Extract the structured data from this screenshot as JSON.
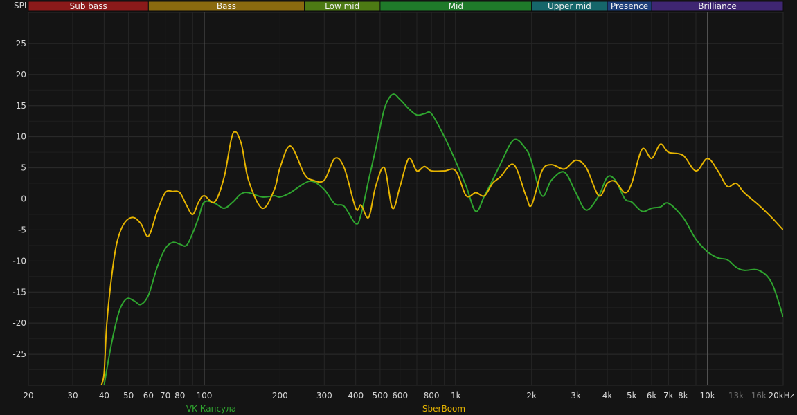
{
  "chart_data": {
    "type": "line",
    "ylabel": "SPL",
    "xscale": "log",
    "xlim": [
      20,
      20000
    ],
    "ylim": [
      -30,
      30
    ],
    "grid": true,
    "y_ticks": [
      25,
      20,
      15,
      10,
      5,
      0,
      -5,
      -10,
      -15,
      -20,
      -25
    ],
    "x_ticks": [
      {
        "value": 20,
        "label": "20",
        "dim": false
      },
      {
        "value": 30,
        "label": "30",
        "dim": false
      },
      {
        "value": 40,
        "label": "40",
        "dim": false
      },
      {
        "value": 50,
        "label": "50",
        "dim": false
      },
      {
        "value": 60,
        "label": "60",
        "dim": false
      },
      {
        "value": 70,
        "label": "70",
        "dim": false
      },
      {
        "value": 80,
        "label": "80",
        "dim": false
      },
      {
        "value": 100,
        "label": "100",
        "dim": false
      },
      {
        "value": 200,
        "label": "200",
        "dim": false
      },
      {
        "value": 300,
        "label": "300",
        "dim": false
      },
      {
        "value": 400,
        "label": "400",
        "dim": false
      },
      {
        "value": 500,
        "label": "500",
        "dim": false
      },
      {
        "value": 600,
        "label": "600",
        "dim": false
      },
      {
        "value": 800,
        "label": "800",
        "dim": false
      },
      {
        "value": 1000,
        "label": "1k",
        "dim": false
      },
      {
        "value": 2000,
        "label": "2k",
        "dim": false
      },
      {
        "value": 3000,
        "label": "3k",
        "dim": false
      },
      {
        "value": 4000,
        "label": "4k",
        "dim": false
      },
      {
        "value": 5000,
        "label": "5k",
        "dim": false
      },
      {
        "value": 6000,
        "label": "6k",
        "dim": false
      },
      {
        "value": 7000,
        "label": "7k",
        "dim": false
      },
      {
        "value": 8000,
        "label": "8k",
        "dim": false
      },
      {
        "value": 10000,
        "label": "10k",
        "dim": false
      },
      {
        "value": 13000,
        "label": "13k",
        "dim": true
      },
      {
        "value": 16000,
        "label": "16k",
        "dim": true
      },
      {
        "value": 20000,
        "label": "20kHz",
        "dim": false
      }
    ],
    "bands": [
      {
        "name": "Sub bass",
        "from": 20,
        "to": 60,
        "color": "#8b1a1a"
      },
      {
        "name": "Bass",
        "from": 60,
        "to": 250,
        "color": "#8a6a0f"
      },
      {
        "name": "Low mid",
        "from": 250,
        "to": 500,
        "color": "#4d7a14"
      },
      {
        "name": "Mid",
        "from": 500,
        "to": 2000,
        "color": "#1f7a2a"
      },
      {
        "name": "Upper mid",
        "from": 2000,
        "to": 4000,
        "color": "#16666a"
      },
      {
        "name": "Presence",
        "from": 4000,
        "to": 6000,
        "color": "#1d3f7a"
      },
      {
        "name": "Brilliance",
        "from": 6000,
        "to": 20000,
        "color": "#3f2672"
      }
    ],
    "series": [
      {
        "name": "VK Капсула",
        "color": "#2fa52f",
        "x": [
          40,
          42,
          44,
          46,
          48,
          50,
          53,
          56,
          60,
          65,
          70,
          75,
          80,
          85,
          90,
          95,
          100,
          110,
          120,
          130,
          140,
          150,
          170,
          190,
          200,
          220,
          250,
          270,
          300,
          330,
          360,
          400,
          420,
          450,
          480,
          520,
          560,
          600,
          650,
          700,
          750,
          800,
          900,
          1000,
          1100,
          1200,
          1300,
          1400,
          1500,
          1700,
          1900,
          2000,
          2200,
          2400,
          2700,
          3000,
          3300,
          3700,
          4000,
          4300,
          4700,
          5000,
          5500,
          6000,
          6500,
          7000,
          8000,
          9000,
          10000,
          11000,
          12000,
          13000,
          14000,
          16000,
          18000,
          20000
        ],
        "values": [
          -30,
          -25,
          -21,
          -18,
          -16.5,
          -16,
          -16.5,
          -17,
          -15.5,
          -11,
          -8,
          -7,
          -7.3,
          -7.5,
          -5.5,
          -3,
          -0.5,
          -0.7,
          -1.5,
          -0.5,
          0.8,
          1.0,
          0.3,
          0.5,
          0.3,
          1.0,
          2.5,
          2.8,
          1.5,
          -0.8,
          -1.2,
          -4.0,
          -2.5,
          3.0,
          8.0,
          14.5,
          16.8,
          16.0,
          14.5,
          13.5,
          13.7,
          13.7,
          10.0,
          6.0,
          2.0,
          -2.0,
          0.5,
          3.0,
          5.5,
          9.5,
          8.0,
          6.0,
          0.5,
          3.0,
          4.3,
          1.0,
          -1.8,
          0.5,
          3.5,
          3.0,
          0.0,
          -0.5,
          -2.0,
          -1.5,
          -1.3,
          -0.7,
          -3.0,
          -6.5,
          -8.5,
          -9.5,
          -9.8,
          -11.0,
          -11.5,
          -11.5,
          -13.5,
          -19.0
        ]
      },
      {
        "name": "SberBoom",
        "color": "#e6b400",
        "x": [
          39,
          40,
          41,
          43,
          45,
          48,
          52,
          56,
          60,
          65,
          70,
          75,
          80,
          85,
          90,
          95,
          100,
          110,
          120,
          130,
          140,
          150,
          170,
          190,
          200,
          220,
          250,
          270,
          300,
          330,
          360,
          400,
          420,
          450,
          480,
          520,
          560,
          600,
          650,
          700,
          750,
          800,
          900,
          1000,
          1100,
          1200,
          1300,
          1400,
          1500,
          1700,
          1900,
          2000,
          2200,
          2400,
          2700,
          3000,
          3300,
          3700,
          4000,
          4300,
          4700,
          5000,
          5500,
          6000,
          6500,
          7000,
          8000,
          9000,
          10000,
          11000,
          12000,
          13000,
          14000,
          16000,
          18000,
          20000
        ],
        "values": [
          -30,
          -28,
          -20,
          -12,
          -7,
          -4,
          -3,
          -4,
          -6,
          -2,
          1.0,
          1.2,
          1.0,
          -1.0,
          -2.5,
          -0.5,
          0.5,
          -0.5,
          3.5,
          10.5,
          9.0,
          3.0,
          -1.5,
          1.5,
          5.0,
          8.5,
          4.0,
          3.0,
          3.0,
          6.5,
          5.0,
          -1.5,
          -1.0,
          -3.0,
          2.0,
          5.0,
          -1.5,
          2.0,
          6.5,
          4.5,
          5.2,
          4.5,
          4.5,
          4.5,
          0.5,
          1.0,
          0.5,
          2.5,
          3.5,
          5.5,
          0.5,
          -1.0,
          4.5,
          5.5,
          4.8,
          6.2,
          5.0,
          0.5,
          2.5,
          2.8,
          1.0,
          2.5,
          8.0,
          6.5,
          8.8,
          7.5,
          7.0,
          4.5,
          6.5,
          4.5,
          2.0,
          2.5,
          1.0,
          -1.0,
          -3.0,
          -5.0
        ]
      }
    ]
  }
}
